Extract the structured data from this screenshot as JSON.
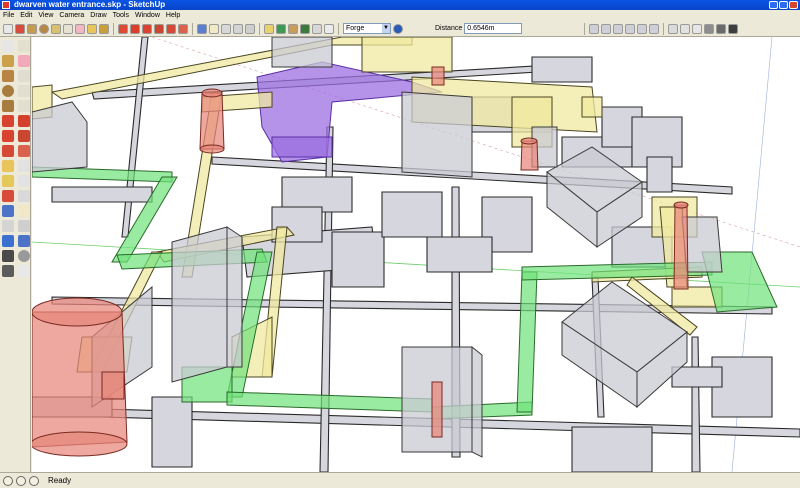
{
  "window": {
    "title": "dwarven water entrance.skp - SketchUp"
  },
  "menu": {
    "items": [
      "File",
      "Edit",
      "View",
      "Camera",
      "Draw",
      "Tools",
      "Window",
      "Help"
    ]
  },
  "toolbar": {
    "layer_value": "Forge",
    "measurements_label": "Distance",
    "measurements_value": "0.6546m"
  },
  "status": {
    "text": "Ready"
  },
  "colors": {
    "corridor_fill": "#d6d6de",
    "corridor_edge": "#2b2b2b",
    "yellow": "#f0eaa0",
    "green": "#6fe27a",
    "purple": "#9b6fe0",
    "red": "#e8867a",
    "glass": "#c9c9d3"
  }
}
